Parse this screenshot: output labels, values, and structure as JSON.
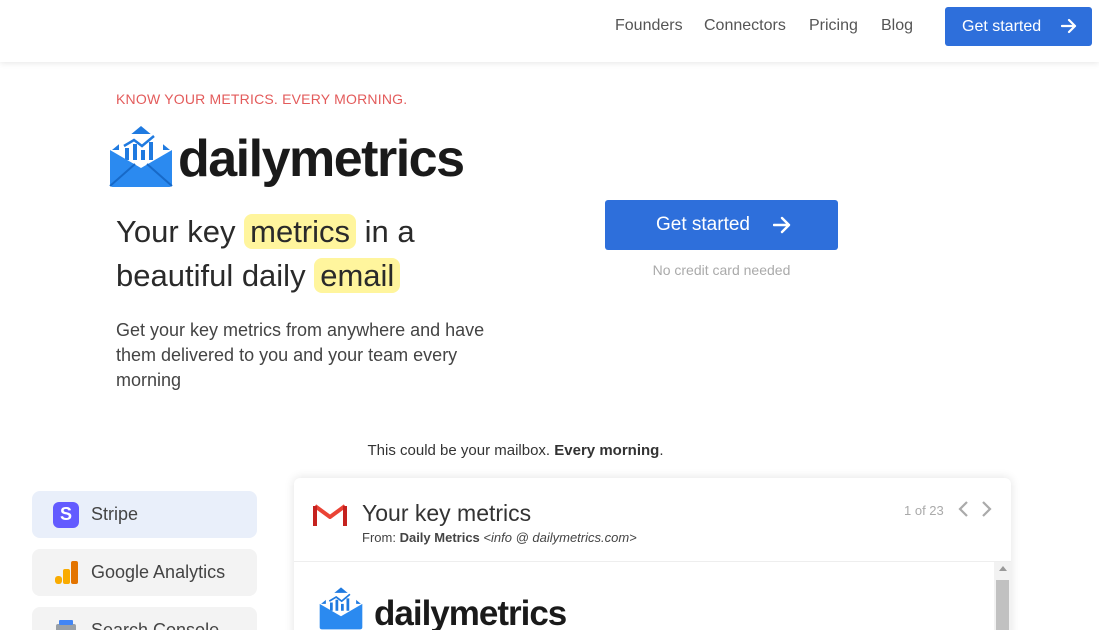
{
  "nav": {
    "links": [
      "Founders",
      "Connectors",
      "Pricing",
      "Blog"
    ],
    "cta_label": "Get started"
  },
  "hero": {
    "eyebrow": "KNOW YOUR METRICS. EVERY MORNING.",
    "logo_text": "dailymetrics",
    "headline_1": "Your key",
    "headline_hl_1": "metrics",
    "headline_2": "in a",
    "headline_3": "beautiful daily",
    "headline_hl_2": "email",
    "subcopy": "Get your key metrics from anywhere and have them delivered to you and your team every morning",
    "cta_label": "Get started",
    "cta_note": "No credit card needed"
  },
  "mailbox_note": {
    "text": "This could be your mailbox.",
    "bold": "Every morning",
    "suffix": "."
  },
  "connectors": [
    {
      "label": "Stripe",
      "icon": "stripe-icon",
      "active": true
    },
    {
      "label": "Google Analytics",
      "icon": "google-analytics-icon",
      "active": false
    },
    {
      "label": "Search Console",
      "icon": "search-console-icon",
      "active": false
    }
  ],
  "email": {
    "subject": "Your key metrics",
    "from_label": "From:",
    "from_name": "Daily Metrics",
    "from_address": "<info @ dailymetrics.com>",
    "pager": "1 of 23",
    "logo_text": "dailymetrics"
  },
  "colors": {
    "brand_blue": "#2e6fdb",
    "eyebrow_red": "#e35b5b",
    "highlight_yellow": "#fff59d",
    "stripe_purple": "#635bff"
  }
}
